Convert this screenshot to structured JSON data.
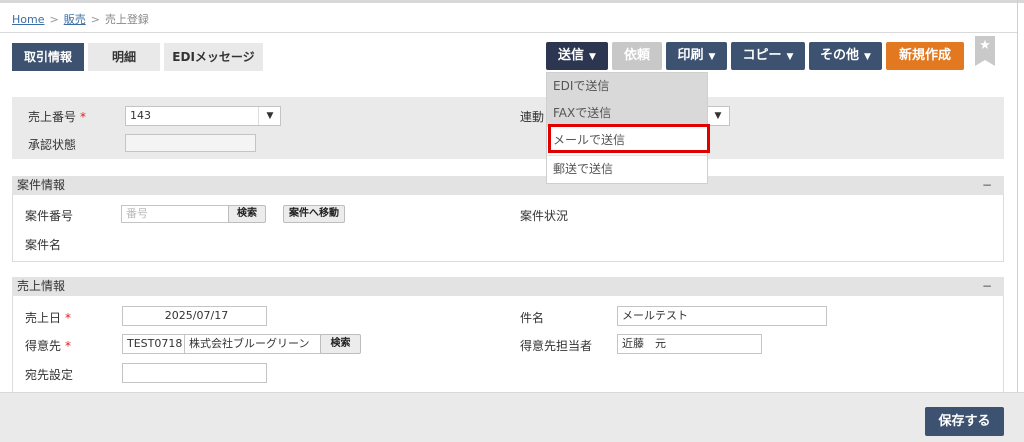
{
  "breadcrumb": {
    "home": "Home",
    "sales": "販売",
    "current": "売上登録",
    "sep": ">"
  },
  "tabs": [
    {
      "label": "取引情報",
      "active": true
    },
    {
      "label": "明細",
      "active": false
    },
    {
      "label": "EDIメッセージ",
      "active": false
    }
  ],
  "toolbar": {
    "send": "送信",
    "request": "依頼",
    "print": "印刷",
    "copy": "コピー",
    "other": "その他",
    "new": "新規作成",
    "star_icon": "star-icon"
  },
  "send_menu": {
    "items": [
      "EDIで送信",
      "FAXで送信",
      "メールで送信",
      "郵送で送信"
    ],
    "highlighted": "メールで送信"
  },
  "header_form": {
    "sales_no_label": "売上番号",
    "sales_no_value": "143",
    "approval_label": "承認状態",
    "approval_value": "",
    "link_label_partial": "連動"
  },
  "project": {
    "title": "案件情報",
    "collapse": "−",
    "no_label": "案件番号",
    "no_placeholder": "番号",
    "search": "検索",
    "goto": "案件へ移動",
    "status_label": "案件状況",
    "name_label": "案件名"
  },
  "sales_info": {
    "title": "売上情報",
    "collapse": "−",
    "date_label": "売上日",
    "date_value": "2025/07/17",
    "subject_label": "件名",
    "subject_value": "メールテスト",
    "customer_label": "得意先",
    "customer_code": "TEST0718",
    "customer_name": "株式会社ブルーグリーン",
    "customer_search": "検索",
    "contact_label": "得意先担当者",
    "contact_value": "近藤　元",
    "dest_label": "宛先設定",
    "dest_value": ""
  },
  "required_mark": "*",
  "footer": {
    "save": "保存する"
  },
  "colors": {
    "navy": "#3d5270",
    "dark_navy": "#2c3650",
    "orange": "#e2781f",
    "highlight_border": "#e00000"
  }
}
